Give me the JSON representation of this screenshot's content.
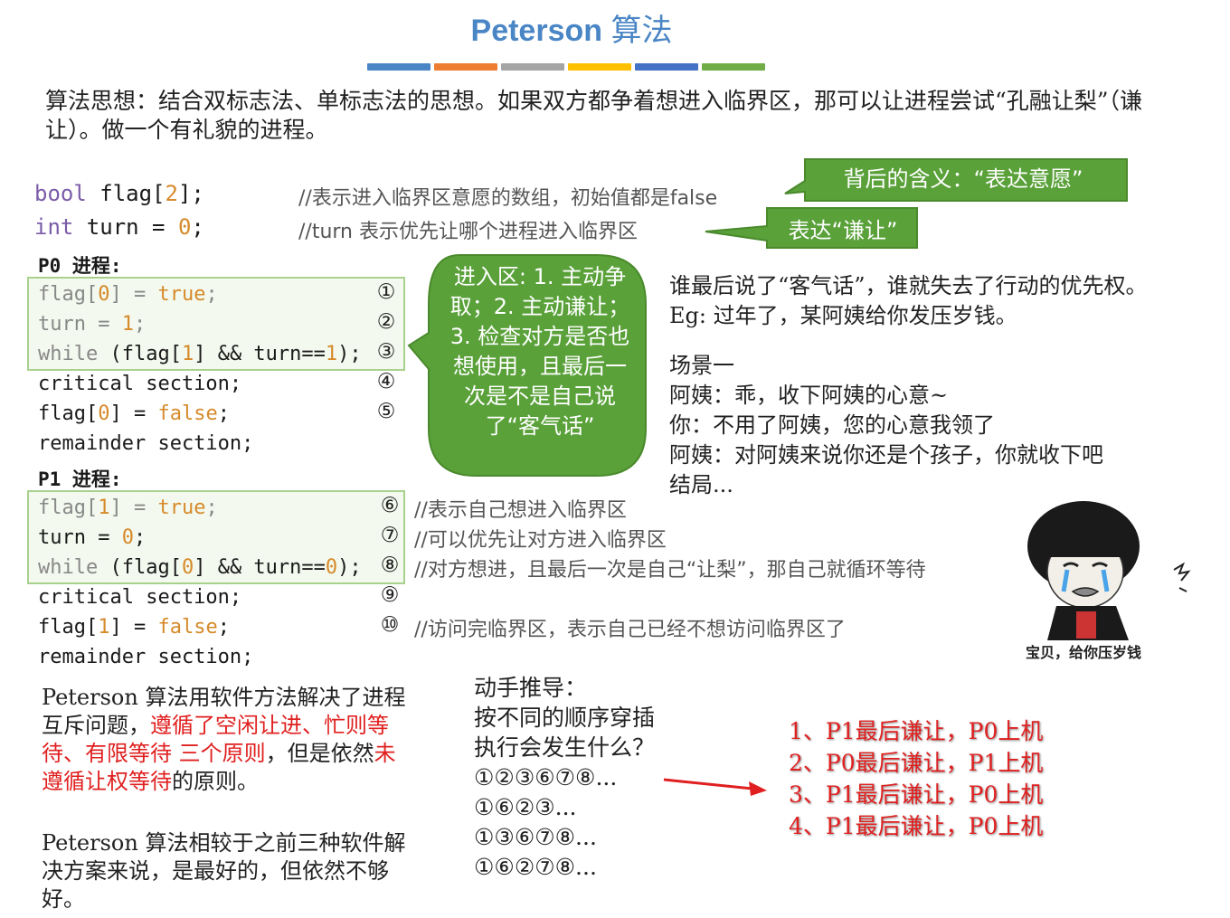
{
  "title": {
    "en": "Peterson",
    "cn": "算法"
  },
  "colorbar": [
    "#4a86c5",
    "#ed7d31",
    "#a5a5a5",
    "#ffc000",
    "#4472c4",
    "#70ad47"
  ],
  "intro": "算法思想：结合双标志法、单标志法的思想。如果双方都争着想进入临界区，那可以让进程尝试“孔融让梨”（谦让）。做一个有礼貌的进程。",
  "decl": {
    "line1": {
      "type": "bool",
      "rest": " flag[",
      "num": "2",
      "end": "];",
      "comment": "//表示进入临界区意愿的数组，初始值都是false"
    },
    "line2": {
      "type": "int",
      "rest": " turn = ",
      "num": "0",
      "end": ";",
      "comment": "//turn 表示优先让哪个进程进入临界区"
    }
  },
  "callouts": {
    "flag_meaning": "背后的含义：“表达意愿”",
    "turn_meaning": "表达“谦让”",
    "entry": "进入区: 1. 主动争取；2. 主动谦让；3. 检查对方是否也想使用，且最后一次是不是自己说了“客气话”"
  },
  "p0": {
    "label": "P0 进程:",
    "l1": {
      "a": "flag[",
      "b": "0",
      "c": "] = ",
      "d": "true",
      "e": ";",
      "mark": "①"
    },
    "l2": {
      "a": "turn = ",
      "b": "1",
      "c": ";",
      "mark": "②"
    },
    "l3": {
      "a": "while",
      "b": " (flag[",
      "c": "1",
      "d": "] && turn==",
      "e": "1",
      "f": ");",
      "mark": "③"
    },
    "l4": {
      "text": "critical section;",
      "mark": "④"
    },
    "l5": {
      "a": "flag[",
      "b": "0",
      "c": "] = ",
      "d": "false",
      "e": ";",
      "mark": "⑤"
    },
    "l6": {
      "text": "remainder section;"
    }
  },
  "p1": {
    "label": "P1 进程:",
    "l1": {
      "a": "flag[",
      "b": "1",
      "c": "] = ",
      "d": "true",
      "e": ";",
      "mark": "⑥",
      "comment": "//表示自己想进入临界区"
    },
    "l2": {
      "a": "turn = ",
      "b": "0",
      "c": ";",
      "mark": "⑦",
      "comment": "//可以优先让对方进入临界区"
    },
    "l3": {
      "a": "while",
      "b": " (flag[",
      "c": "0",
      "d": "] && turn==",
      "e": "0",
      "f": ");",
      "mark": "⑧",
      "comment": "//对方想进，且最后一次是自己“让梨”，那自己就循环等待"
    },
    "l4": {
      "text": "critical section;",
      "mark": "⑨"
    },
    "l5": {
      "a": "flag[",
      "b": "1",
      "c": "] = ",
      "d": "false",
      "e": ";",
      "mark": "⑩",
      "comment": "//访问完临界区，表示自己已经不想访问临界区了"
    },
    "l6": {
      "text": "remainder section;"
    }
  },
  "story": {
    "s1": "谁最后说了“客气话”，谁就失去了行动的优先权。",
    "s2": "Eg: 过年了，某阿姨给你发压岁钱。",
    "s3": "场景一",
    "s4": "阿姨：乖，收下阿姨的心意~",
    "s5": "你：不用了阿姨，您的心意我领了",
    "s6": "阿姨：对阿姨来说你还是个孩子，你就收下吧",
    "s7": "结局..."
  },
  "meme_caption": "宝贝，给你压岁钱",
  "summary1": {
    "a": "Peterson 算法用软件方法解决了进程互斥问题，",
    "b": "遵循了空闲让进、忙则等待、有限等待 三个原则",
    "c": "，但是依然",
    "d": "未遵循让权等待",
    "e": "的原则。"
  },
  "summary2": "Peterson 算法相较于之前三种软件解决方案来说，是最好的，但依然不够好。",
  "derive": {
    "title": "动手推导：",
    "q1": "按不同的顺序穿插",
    "q2": "执行会发生什么？",
    "seqs": [
      "①②③⑥⑦⑧...",
      "①⑥②③...",
      "①③⑥⑦⑧...",
      "①⑥②⑦⑧..."
    ]
  },
  "results": [
    "1、P1最后谦让，P0上机",
    "2、P0最后谦让，P1上机",
    "3、P1最后谦让，P0上机",
    "4、P1最后谦让，P0上机"
  ]
}
